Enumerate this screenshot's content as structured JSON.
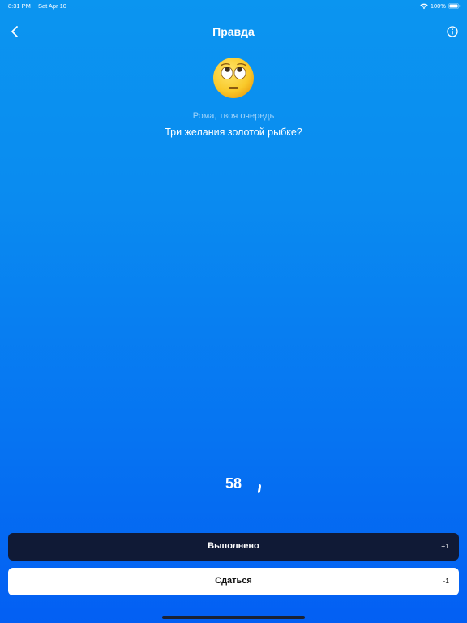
{
  "status_bar": {
    "time": "8:31 PM",
    "date": "Sat Apr 10",
    "battery": "100%"
  },
  "nav": {
    "title": "Правда"
  },
  "turn": {
    "label": "Рома, твоя очередь"
  },
  "question": {
    "text": "Три желания золотой рыбке?"
  },
  "timer": {
    "value": "58"
  },
  "actions": {
    "done": {
      "label": "Выполнено",
      "score": "+1"
    },
    "surrender": {
      "label": "Сдаться",
      "score": "-1"
    }
  },
  "colors": {
    "background_top": "#0b95f0",
    "background_bottom": "#035ff3",
    "done_button": "#101a36",
    "surrender_button": "#ffffff"
  },
  "icons": {
    "back": "chevron-left-icon",
    "info": "info-circle-icon",
    "emoji": "face-with-rolling-eyes-emoji"
  }
}
